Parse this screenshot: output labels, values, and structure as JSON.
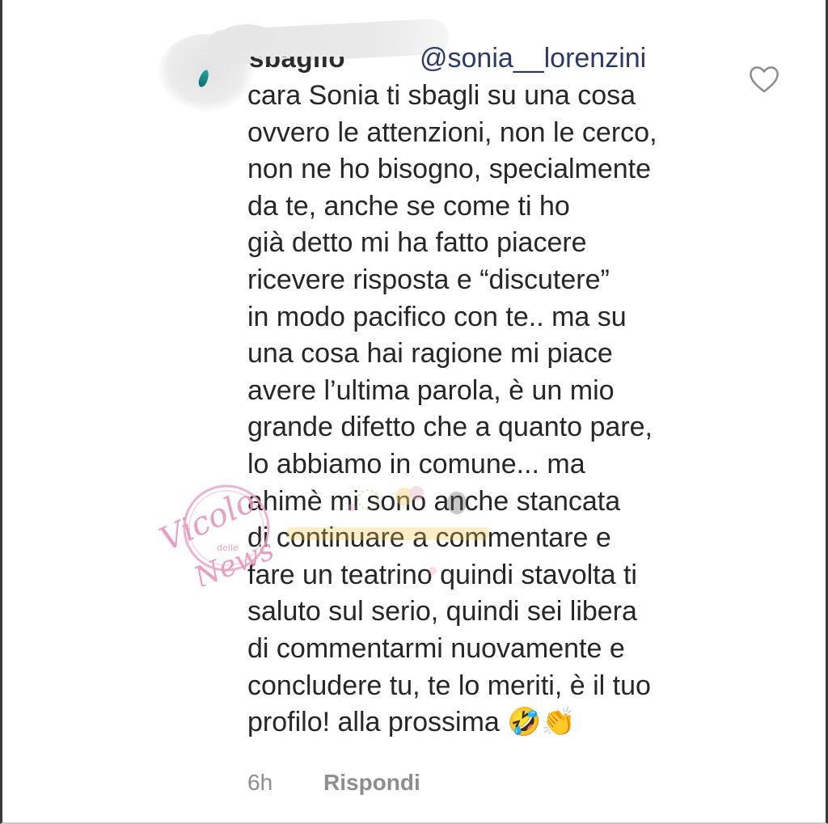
{
  "comment": {
    "mention": "@sonia__lorenzini",
    "username_partial": "sbaglio",
    "body": "cara Sonia ti sbagli su una cosa\novvero le attenzioni, non le cerco,\nnon ne ho bisogno, specialmente\nda te, anche se come ti ho\ngià detto mi ha fatto piacere\nricevere risposta e “discutere”\nin modo pacifico con te.. ma su\nuna cosa hai ragione mi piace\navere l’ultima parola, è un mio\ngrande difetto che a quanto pare,\nlo abbiamo in comune... ma\nahimè mi sono anche stancata\ndi continuare a commentare e\nfare un teatrino quindi stavolta ti\nsaluto sul serio, quindi sei libera\ndi commentarmi nuovamente e\nconcludere tu, te lo meriti, è il tuo\nprofilo! alla prossima 🤣👏",
    "time": "6h",
    "reply_label": "Rispondi",
    "like_icon": "heart-outline-icon"
  },
  "watermark": {
    "text": "Vicolo delle News"
  },
  "colors": {
    "text": "#262626",
    "mention": "#2e3a66",
    "meta": "#8e8e8e",
    "watermark_pink": "#e9a6c6"
  }
}
